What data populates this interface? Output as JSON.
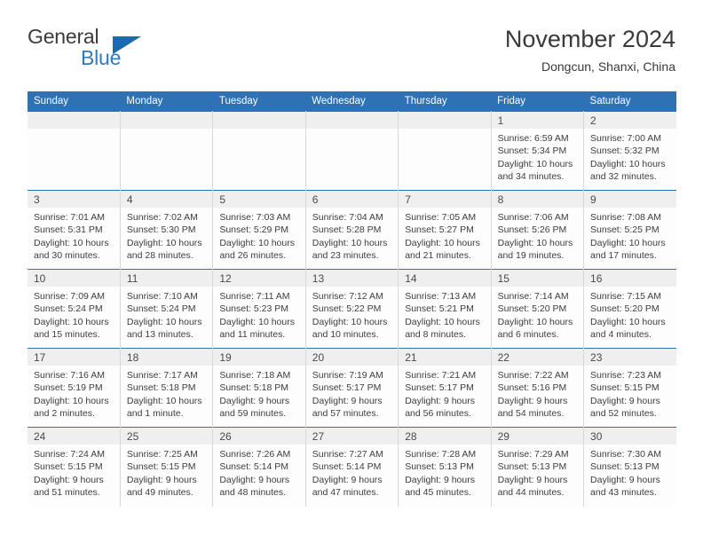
{
  "brand": {
    "name_part1": "General",
    "name_part2": "Blue",
    "accent_color": "#2E71B5",
    "logo_mark": "triangle-mark"
  },
  "header": {
    "title": "November 2024",
    "subtitle": "Dongcun, Shanxi, China"
  },
  "calendar": {
    "weekday_headers": [
      "Sunday",
      "Monday",
      "Tuesday",
      "Wednesday",
      "Thursday",
      "Friday",
      "Saturday"
    ],
    "header_bg": "#2E71B5",
    "daynum_band_bg": "#efefef",
    "weeks": [
      [
        {
          "day": "",
          "sunrise": "",
          "sunset": "",
          "daylight": "",
          "empty": true
        },
        {
          "day": "",
          "sunrise": "",
          "sunset": "",
          "daylight": "",
          "empty": true
        },
        {
          "day": "",
          "sunrise": "",
          "sunset": "",
          "daylight": "",
          "empty": true
        },
        {
          "day": "",
          "sunrise": "",
          "sunset": "",
          "daylight": "",
          "empty": true
        },
        {
          "day": "",
          "sunrise": "",
          "sunset": "",
          "daylight": "",
          "empty": true
        },
        {
          "day": "1",
          "sunrise": "Sunrise: 6:59 AM",
          "sunset": "Sunset: 5:34 PM",
          "daylight": "Daylight: 10 hours and 34 minutes.",
          "empty": false
        },
        {
          "day": "2",
          "sunrise": "Sunrise: 7:00 AM",
          "sunset": "Sunset: 5:32 PM",
          "daylight": "Daylight: 10 hours and 32 minutes.",
          "empty": false
        }
      ],
      [
        {
          "day": "3",
          "sunrise": "Sunrise: 7:01 AM",
          "sunset": "Sunset: 5:31 PM",
          "daylight": "Daylight: 10 hours and 30 minutes.",
          "empty": false
        },
        {
          "day": "4",
          "sunrise": "Sunrise: 7:02 AM",
          "sunset": "Sunset: 5:30 PM",
          "daylight": "Daylight: 10 hours and 28 minutes.",
          "empty": false
        },
        {
          "day": "5",
          "sunrise": "Sunrise: 7:03 AM",
          "sunset": "Sunset: 5:29 PM",
          "daylight": "Daylight: 10 hours and 26 minutes.",
          "empty": false
        },
        {
          "day": "6",
          "sunrise": "Sunrise: 7:04 AM",
          "sunset": "Sunset: 5:28 PM",
          "daylight": "Daylight: 10 hours and 23 minutes.",
          "empty": false
        },
        {
          "day": "7",
          "sunrise": "Sunrise: 7:05 AM",
          "sunset": "Sunset: 5:27 PM",
          "daylight": "Daylight: 10 hours and 21 minutes.",
          "empty": false
        },
        {
          "day": "8",
          "sunrise": "Sunrise: 7:06 AM",
          "sunset": "Sunset: 5:26 PM",
          "daylight": "Daylight: 10 hours and 19 minutes.",
          "empty": false
        },
        {
          "day": "9",
          "sunrise": "Sunrise: 7:08 AM",
          "sunset": "Sunset: 5:25 PM",
          "daylight": "Daylight: 10 hours and 17 minutes.",
          "empty": false
        }
      ],
      [
        {
          "day": "10",
          "sunrise": "Sunrise: 7:09 AM",
          "sunset": "Sunset: 5:24 PM",
          "daylight": "Daylight: 10 hours and 15 minutes.",
          "empty": false
        },
        {
          "day": "11",
          "sunrise": "Sunrise: 7:10 AM",
          "sunset": "Sunset: 5:24 PM",
          "daylight": "Daylight: 10 hours and 13 minutes.",
          "empty": false
        },
        {
          "day": "12",
          "sunrise": "Sunrise: 7:11 AM",
          "sunset": "Sunset: 5:23 PM",
          "daylight": "Daylight: 10 hours and 11 minutes.",
          "empty": false
        },
        {
          "day": "13",
          "sunrise": "Sunrise: 7:12 AM",
          "sunset": "Sunset: 5:22 PM",
          "daylight": "Daylight: 10 hours and 10 minutes.",
          "empty": false
        },
        {
          "day": "14",
          "sunrise": "Sunrise: 7:13 AM",
          "sunset": "Sunset: 5:21 PM",
          "daylight": "Daylight: 10 hours and 8 minutes.",
          "empty": false
        },
        {
          "day": "15",
          "sunrise": "Sunrise: 7:14 AM",
          "sunset": "Sunset: 5:20 PM",
          "daylight": "Daylight: 10 hours and 6 minutes.",
          "empty": false
        },
        {
          "day": "16",
          "sunrise": "Sunrise: 7:15 AM",
          "sunset": "Sunset: 5:20 PM",
          "daylight": "Daylight: 10 hours and 4 minutes.",
          "empty": false
        }
      ],
      [
        {
          "day": "17",
          "sunrise": "Sunrise: 7:16 AM",
          "sunset": "Sunset: 5:19 PM",
          "daylight": "Daylight: 10 hours and 2 minutes.",
          "empty": false
        },
        {
          "day": "18",
          "sunrise": "Sunrise: 7:17 AM",
          "sunset": "Sunset: 5:18 PM",
          "daylight": "Daylight: 10 hours and 1 minute.",
          "empty": false
        },
        {
          "day": "19",
          "sunrise": "Sunrise: 7:18 AM",
          "sunset": "Sunset: 5:18 PM",
          "daylight": "Daylight: 9 hours and 59 minutes.",
          "empty": false
        },
        {
          "day": "20",
          "sunrise": "Sunrise: 7:19 AM",
          "sunset": "Sunset: 5:17 PM",
          "daylight": "Daylight: 9 hours and 57 minutes.",
          "empty": false
        },
        {
          "day": "21",
          "sunrise": "Sunrise: 7:21 AM",
          "sunset": "Sunset: 5:17 PM",
          "daylight": "Daylight: 9 hours and 56 minutes.",
          "empty": false
        },
        {
          "day": "22",
          "sunrise": "Sunrise: 7:22 AM",
          "sunset": "Sunset: 5:16 PM",
          "daylight": "Daylight: 9 hours and 54 minutes.",
          "empty": false
        },
        {
          "day": "23",
          "sunrise": "Sunrise: 7:23 AM",
          "sunset": "Sunset: 5:15 PM",
          "daylight": "Daylight: 9 hours and 52 minutes.",
          "empty": false
        }
      ],
      [
        {
          "day": "24",
          "sunrise": "Sunrise: 7:24 AM",
          "sunset": "Sunset: 5:15 PM",
          "daylight": "Daylight: 9 hours and 51 minutes.",
          "empty": false
        },
        {
          "day": "25",
          "sunrise": "Sunrise: 7:25 AM",
          "sunset": "Sunset: 5:15 PM",
          "daylight": "Daylight: 9 hours and 49 minutes.",
          "empty": false
        },
        {
          "day": "26",
          "sunrise": "Sunrise: 7:26 AM",
          "sunset": "Sunset: 5:14 PM",
          "daylight": "Daylight: 9 hours and 48 minutes.",
          "empty": false
        },
        {
          "day": "27",
          "sunrise": "Sunrise: 7:27 AM",
          "sunset": "Sunset: 5:14 PM",
          "daylight": "Daylight: 9 hours and 47 minutes.",
          "empty": false
        },
        {
          "day": "28",
          "sunrise": "Sunrise: 7:28 AM",
          "sunset": "Sunset: 5:13 PM",
          "daylight": "Daylight: 9 hours and 45 minutes.",
          "empty": false
        },
        {
          "day": "29",
          "sunrise": "Sunrise: 7:29 AM",
          "sunset": "Sunset: 5:13 PM",
          "daylight": "Daylight: 9 hours and 44 minutes.",
          "empty": false
        },
        {
          "day": "30",
          "sunrise": "Sunrise: 7:30 AM",
          "sunset": "Sunset: 5:13 PM",
          "daylight": "Daylight: 9 hours and 43 minutes.",
          "empty": false
        }
      ]
    ]
  }
}
